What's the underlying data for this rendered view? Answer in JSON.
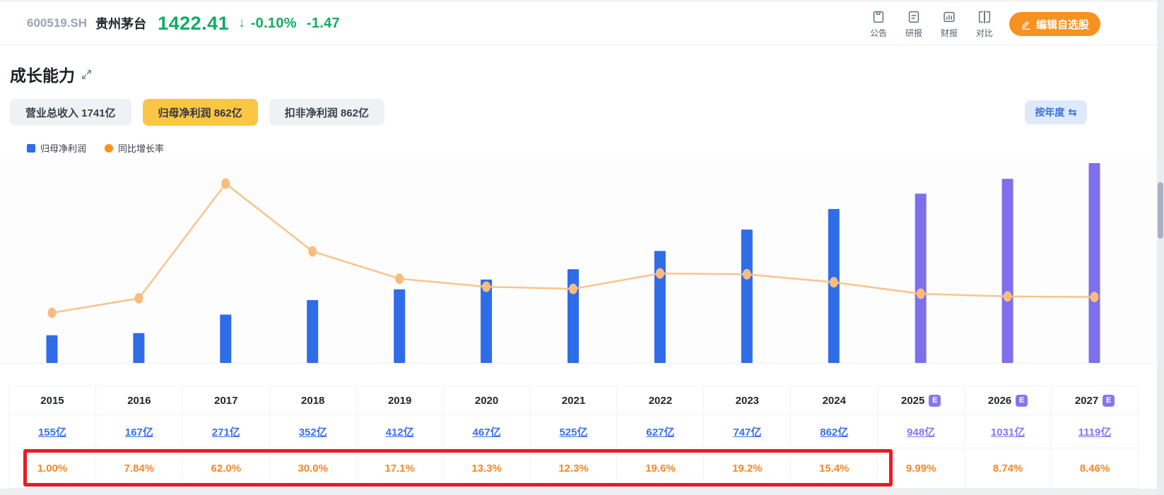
{
  "header": {
    "symbol": "600519.SH",
    "name": "贵州茅台",
    "price": "1422.41",
    "down_arrow": "↓",
    "change_percent": "-0.10%",
    "change_value": "-1.47",
    "price_color": "#0ead66",
    "actions": [
      {
        "label": "公告",
        "icon": "announcement-icon"
      },
      {
        "label": "研报",
        "icon": "research-report-icon"
      },
      {
        "label": "财报",
        "icon": "financial-report-icon"
      },
      {
        "label": "对比",
        "icon": "compare-icon"
      }
    ],
    "edit_button_label": "编辑自选股"
  },
  "section": {
    "title": "成长能力",
    "tabs": [
      {
        "label": "营业总收入 1741亿",
        "active": false
      },
      {
        "label": "归母净利润 862亿",
        "active": true
      },
      {
        "label": "扣非净利润 862亿",
        "active": false
      }
    ],
    "period_toggle_label": "按年度",
    "period_toggle_icon": "⇆",
    "legend": [
      {
        "label": "归母净利润",
        "color": "#2f6ce8",
        "shape": "square"
      },
      {
        "label": "同比增长率",
        "color": "#f8921d",
        "shape": "circle"
      }
    ]
  },
  "chart_data": {
    "type": "bar+line",
    "categories": [
      "2015",
      "2016",
      "2017",
      "2018",
      "2019",
      "2020",
      "2021",
      "2022",
      "2023",
      "2024",
      "2025",
      "2026",
      "2027"
    ],
    "estimate_categories": [
      "2025",
      "2026",
      "2027"
    ],
    "series": [
      {
        "name": "归母净利润",
        "type": "bar",
        "unit": "亿",
        "values": [
          155,
          167,
          271,
          352,
          412,
          467,
          525,
          627,
          747,
          862,
          948,
          1031,
          1119
        ]
      },
      {
        "name": "同比增长率",
        "type": "line",
        "unit": "%",
        "values": [
          1.0,
          7.84,
          62.0,
          30.0,
          17.1,
          13.3,
          12.3,
          19.6,
          19.2,
          15.4,
          9.99,
          8.74,
          8.46
        ]
      }
    ],
    "legend_position": "top-left",
    "grid": false,
    "colors": {
      "bar": "#2f6ce8",
      "bar_estimate": "#7e6fec",
      "line": "#f9c48c",
      "point": "#f8bc7e"
    }
  },
  "table": {
    "estimate_badge": "E",
    "years": [
      "2015",
      "2016",
      "2017",
      "2018",
      "2019",
      "2020",
      "2021",
      "2022",
      "2023",
      "2024",
      "2025",
      "2026",
      "2027"
    ],
    "estimate_years": [
      "2025",
      "2026",
      "2027"
    ],
    "values": [
      "155亿",
      "167亿",
      "271亿",
      "352亿",
      "412亿",
      "467亿",
      "525亿",
      "627亿",
      "747亿",
      "862亿",
      "948亿",
      "1031亿",
      "1119亿"
    ],
    "growth": [
      "1.00%",
      "7.84%",
      "62.0%",
      "30.0%",
      "17.1%",
      "13.3%",
      "12.3%",
      "19.6%",
      "19.2%",
      "15.4%",
      "9.99%",
      "8.74%",
      "8.46%"
    ],
    "highlight": {
      "type": "red-box",
      "row": "growth",
      "from_year": "2015",
      "to_year": "2024",
      "color": "#ea1b22"
    }
  }
}
